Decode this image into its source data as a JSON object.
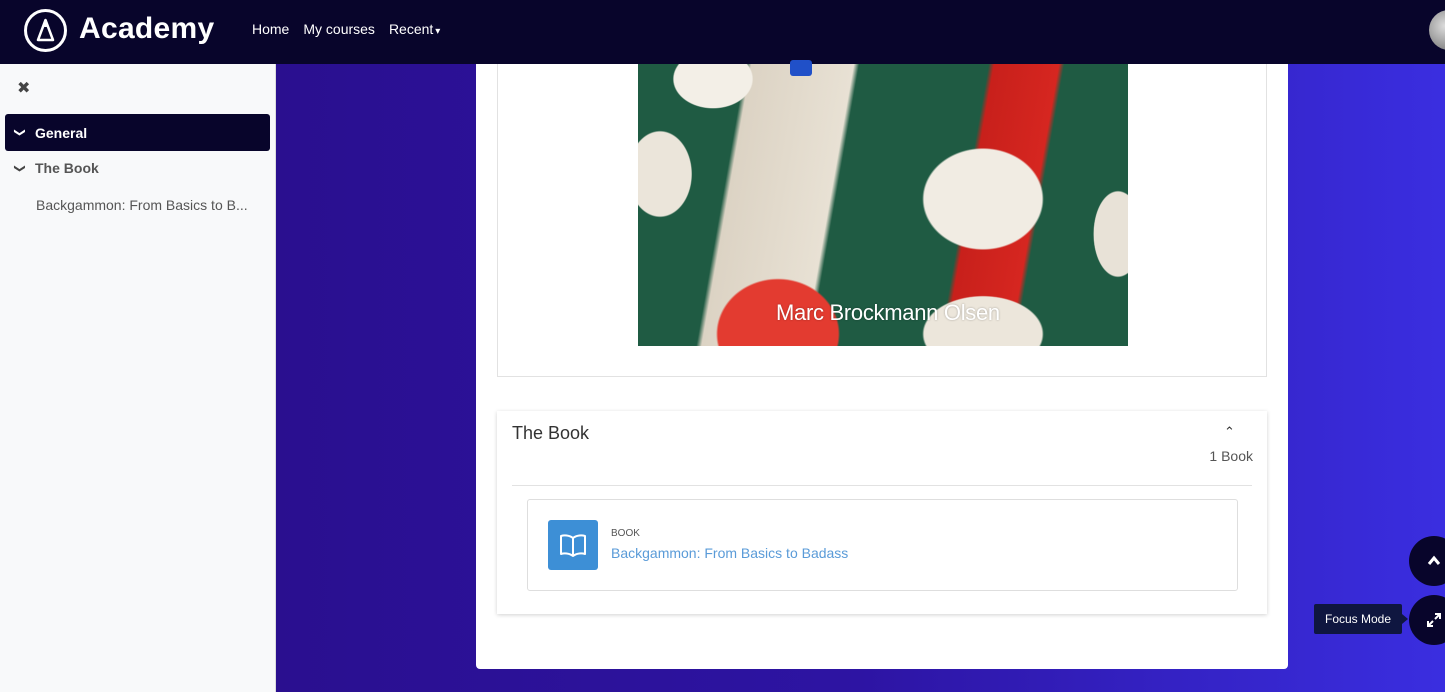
{
  "header": {
    "brand": "Academy",
    "nav": {
      "home": "Home",
      "my_courses": "My courses",
      "recent": "Recent"
    }
  },
  "drawer": {
    "close_icon": "close-icon",
    "sections": [
      {
        "label": "General",
        "active": true
      },
      {
        "label": "The Book",
        "active": false
      }
    ],
    "activity_label": "Backgammon: From Basics to B..."
  },
  "summary": {
    "image_caption": "Marc Brockmann Olsen"
  },
  "book_section": {
    "title": "The Book",
    "count": "1 Book",
    "activity": {
      "type": "BOOK",
      "name": "Backgammon: From Basics to Badass"
    }
  },
  "floating": {
    "focus_tooltip": "Focus Mode"
  },
  "colors": {
    "navbar": "#08052b",
    "accent": "#3d8fd6",
    "link": "#5a9bd8"
  }
}
